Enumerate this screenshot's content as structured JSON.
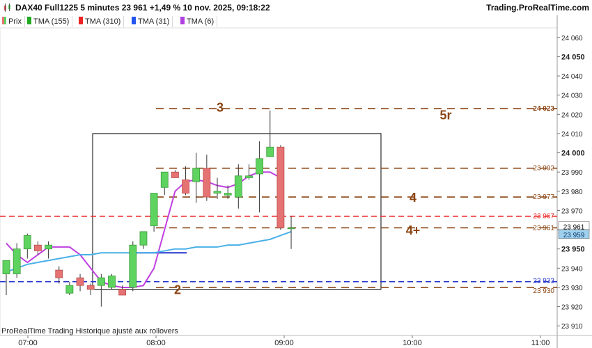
{
  "title_text": "DAX40 Full1225 5 minutes 23 961 +1,49 % 10 nov. 2025, 09:18:22",
  "brand": "Trading.ProRealTime.com",
  "legend": [
    {
      "label": "Prix",
      "color": "#d9534f"
    },
    {
      "label": "TMA (155)",
      "color": "#22aa22"
    },
    {
      "label": "TMA (310)",
      "color": "#ee2222"
    },
    {
      "label": "TMA (31)",
      "color": "#2255ee"
    },
    {
      "label": "TMA (6)",
      "color": "#b040e0"
    }
  ],
  "footer_note": "ProRealTime Trading  Historique ajusté aux rollovers",
  "colors": {
    "bull": "#5fd35f",
    "bear": "#e57373",
    "level": "#8b4513",
    "red_line": "#ee2222",
    "blue_line": "#2233cc",
    "tma6": "#c040e0",
    "tma_light": "#4ab0e8"
  },
  "chart_data": {
    "type": "candlestick",
    "instrument": "DAX40 Full1225",
    "timeframe": "5 minutes",
    "last_price": 23961,
    "change_pct": "+1,49 %",
    "datetime": "10 nov. 2025, 09:18:22",
    "y_axis": {
      "min": 23905,
      "max": 24065,
      "ticks": [
        23910,
        23920,
        23930,
        23940,
        23950,
        23960,
        23970,
        23980,
        23990,
        24000,
        24010,
        24020,
        24030,
        24040,
        24050,
        24060
      ],
      "tick_labels": [
        "23 910",
        "23 920",
        "23 930",
        "23 940",
        "23 950",
        "23 960",
        "23 970",
        "23 980",
        "23 990",
        "24 000",
        "24 010",
        "24 020",
        "24 030",
        "24 040",
        "24 050",
        "24 060"
      ],
      "bold_ticks": [
        23950,
        24000,
        24050
      ]
    },
    "x_axis": {
      "labels": [
        "07:00",
        "08:00",
        "09:00",
        "10:00",
        "11:00"
      ]
    },
    "candles": [
      {
        "o": 23937,
        "h": 23944,
        "l": 23926,
        "c": 23944
      },
      {
        "o": 23937,
        "h": 23953,
        "l": 23935,
        "c": 23950
      },
      {
        "o": 23950,
        "h": 23958,
        "l": 23945,
        "c": 23957
      },
      {
        "o": 23952,
        "h": 23954,
        "l": 23947,
        "c": 23949
      },
      {
        "o": 23950,
        "h": 23954,
        "l": 23945,
        "c": 23952
      },
      {
        "o": 23939,
        "h": 23941,
        "l": 23932,
        "c": 23935
      },
      {
        "o": 23927,
        "h": 23933,
        "l": 23926,
        "c": 23931
      },
      {
        "o": 23935,
        "h": 23937,
        "l": 23928,
        "c": 23931
      },
      {
        "o": 23931,
        "h": 23932,
        "l": 23926,
        "c": 23929
      },
      {
        "o": 23931,
        "h": 23937,
        "l": 23920,
        "c": 23935
      },
      {
        "o": 23930,
        "h": 23937,
        "l": 23929,
        "c": 23936
      },
      {
        "o": 23929,
        "h": 23931,
        "l": 23926,
        "c": 23926
      },
      {
        "o": 23930,
        "h": 23954,
        "l": 23928,
        "c": 23952
      },
      {
        "o": 23952,
        "h": 23959,
        "l": 23950,
        "c": 23959
      },
      {
        "o": 23962,
        "h": 23974,
        "l": 23959,
        "c": 23979
      },
      {
        "o": 23982,
        "h": 23989,
        "l": 23978,
        "c": 23990
      },
      {
        "o": 23990,
        "h": 23991,
        "l": 23987,
        "c": 23987
      },
      {
        "o": 23986,
        "h": 23993,
        "l": 23978,
        "c": 23979
      },
      {
        "o": 23985,
        "h": 24000,
        "l": 23974,
        "c": 23992
      },
      {
        "o": 23992,
        "h": 23999,
        "l": 23975,
        "c": 23977
      },
      {
        "o": 23979,
        "h": 23987,
        "l": 23976,
        "c": 23980
      },
      {
        "o": 23978,
        "h": 23983,
        "l": 23976,
        "c": 23979
      },
      {
        "o": 23977,
        "h": 23994,
        "l": 23971,
        "c": 23988
      },
      {
        "o": 23987,
        "h": 23994,
        "l": 23986,
        "c": 23988
      },
      {
        "o": 23989,
        "h": 24006,
        "l": 23969,
        "c": 23997
      },
      {
        "o": 23998,
        "h": 24022,
        "l": 23998,
        "c": 24003
      },
      {
        "o": 24003,
        "h": 24004,
        "l": 23960,
        "c": 23961
      },
      {
        "o": 23961,
        "h": 23967,
        "l": 23950,
        "c": 23961
      }
    ],
    "series": [
      {
        "name": "TMA (6)",
        "values": [
          23953,
          23947,
          23943,
          23947,
          23951,
          23951,
          23951,
          23947,
          23940,
          23933,
          23931,
          23930,
          23930,
          23931,
          23940,
          23960,
          23980,
          23985,
          23986,
          23985,
          23983,
          23982,
          23984,
          23988,
          23990,
          23990,
          23987
        ]
      },
      {
        "name": "TMA (155)",
        "values": [
          23938,
          23940,
          23942,
          23943,
          23944,
          23945,
          23946,
          23947,
          23947,
          23948,
          23948,
          23948,
          23948,
          23948,
          23948,
          23949,
          23950,
          23950,
          23951,
          23951,
          23951,
          23952,
          23952,
          23953,
          23954,
          23955,
          23957,
          23959
        ]
      }
    ],
    "tma31_segment_value": 23948,
    "horizontal_lines": [
      {
        "value": 24023,
        "label": "24 023",
        "style": "dashed",
        "color": "#8b4513"
      },
      {
        "value": 23992,
        "label": "23 992",
        "style": "dashed",
        "color": "#8b4513"
      },
      {
        "value": 23977,
        "label": "23 977",
        "style": "dashed",
        "color": "#8b4513"
      },
      {
        "value": 23967,
        "label": "23 967",
        "style": "dashed",
        "color": "#ee2222"
      },
      {
        "value": 23961,
        "label": "23 961",
        "style": "dashed",
        "color": "#8b4513"
      },
      {
        "value": 23933,
        "label": "23 933",
        "style": "dashed",
        "color": "#2233cc"
      },
      {
        "value": 23930,
        "label": "23 930",
        "style": "dashed",
        "color": "#8b4513"
      }
    ],
    "price_flags": [
      {
        "value": 23961,
        "label": "23 961",
        "bg": "#ffffff",
        "fg": "#111111"
      },
      {
        "value": 23959,
        "label": "23 959",
        "bg": "#9fd0ee",
        "fg": "#0a3a66"
      }
    ],
    "annotations": [
      {
        "text": "3",
        "value": 24024
      },
      {
        "text": "5r",
        "value": 24020
      },
      {
        "text": "4",
        "value": 23977
      },
      {
        "text": "4+",
        "value": 23960
      },
      {
        "text": "2",
        "value": 23929
      }
    ],
    "box": {
      "top": 24010,
      "bottom": 23929
    },
    "grid": false,
    "legend_position": "top-left"
  }
}
